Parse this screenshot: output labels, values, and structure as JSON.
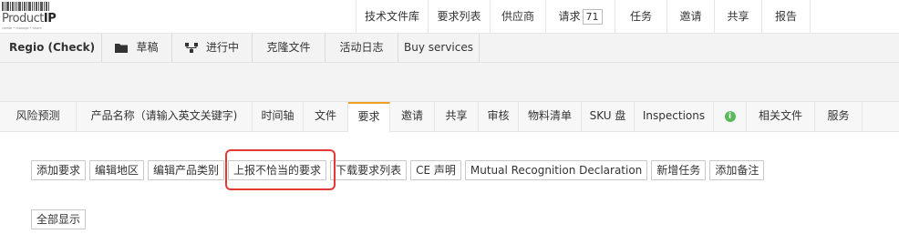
{
  "logo": {
    "brand_light": "Product",
    "brand_bold": "IP",
    "tagline": "create • manage • share"
  },
  "topnav": {
    "items": [
      {
        "label": "技术文件库"
      },
      {
        "label": "要求列表"
      },
      {
        "label": "供应商"
      },
      {
        "label": "请求",
        "count": "71"
      },
      {
        "label": "任务"
      },
      {
        "label": "邀请"
      },
      {
        "label": "共享"
      },
      {
        "label": "报告"
      }
    ]
  },
  "project": {
    "title": "Regio (Check)",
    "items": [
      {
        "label": "草稿",
        "icon": "folder-icon"
      },
      {
        "label": "进行中",
        "icon": "sitemap-icon"
      },
      {
        "label": "克隆文件"
      },
      {
        "label": "活动日志"
      },
      {
        "label": "Buy services"
      }
    ]
  },
  "tabs": [
    {
      "label": "风险预测"
    },
    {
      "label": "产品名称（请输入英文关键字)"
    },
    {
      "label": "时间轴"
    },
    {
      "label": "文件"
    },
    {
      "label": "要求",
      "active": true
    },
    {
      "label": "邀请"
    },
    {
      "label": "共享"
    },
    {
      "label": "审核"
    },
    {
      "label": "物料清单"
    },
    {
      "label": "SKU 盘"
    },
    {
      "label": "Inspections"
    },
    {
      "label": "",
      "icon": "info-icon"
    },
    {
      "label": "相关文件"
    },
    {
      "label": "服务"
    }
  ],
  "actions": [
    {
      "label": "添加要求"
    },
    {
      "label": "编辑地区"
    },
    {
      "label": "编辑产品类别"
    },
    {
      "label": "上报不恰当的要求",
      "highlighted": true
    },
    {
      "label": "下载要求列表"
    },
    {
      "label": "CE 声明"
    },
    {
      "label": "Mutual Recognition Declaration"
    },
    {
      "label": "新增任务"
    },
    {
      "label": "添加备注"
    }
  ],
  "show_all": "全部显示",
  "colors": {
    "active_tab": "#f0a020",
    "highlight": "#e53935",
    "info": "#5cb85c"
  }
}
